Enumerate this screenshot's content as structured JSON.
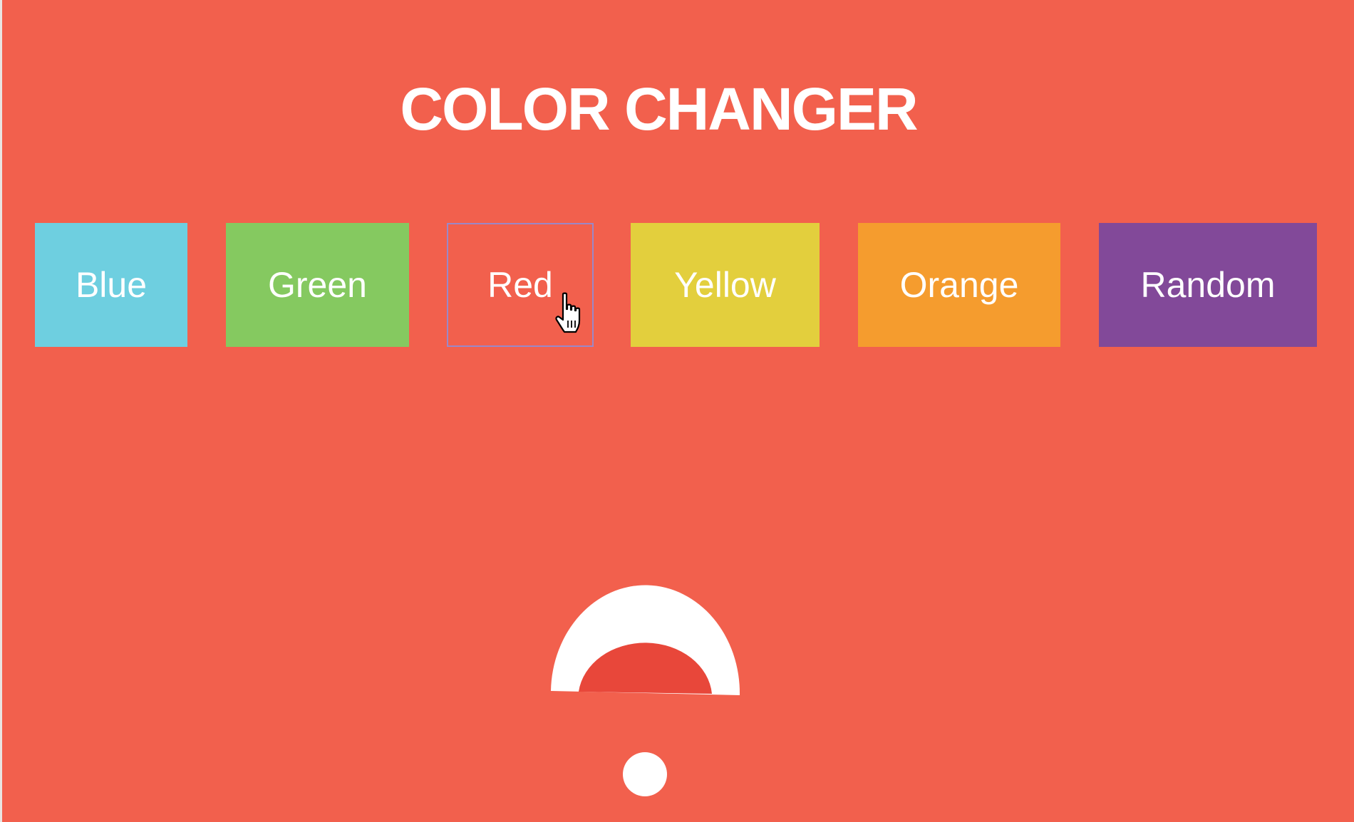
{
  "title": "COLOR CHANGER",
  "background_color": "#f2604d",
  "buttons": [
    {
      "label": "Blue",
      "color": "#6ecfe0"
    },
    {
      "label": "Green",
      "color": "#85c960"
    },
    {
      "label": "Red",
      "color": "#f2604d"
    },
    {
      "label": "Yellow",
      "color": "#e3cf3d"
    },
    {
      "label": "Orange",
      "color": "#f59c2e"
    },
    {
      "label": "Random",
      "color": "#824999"
    }
  ],
  "active_button": "Red",
  "cursor_icon": "hand-pointer-icon"
}
